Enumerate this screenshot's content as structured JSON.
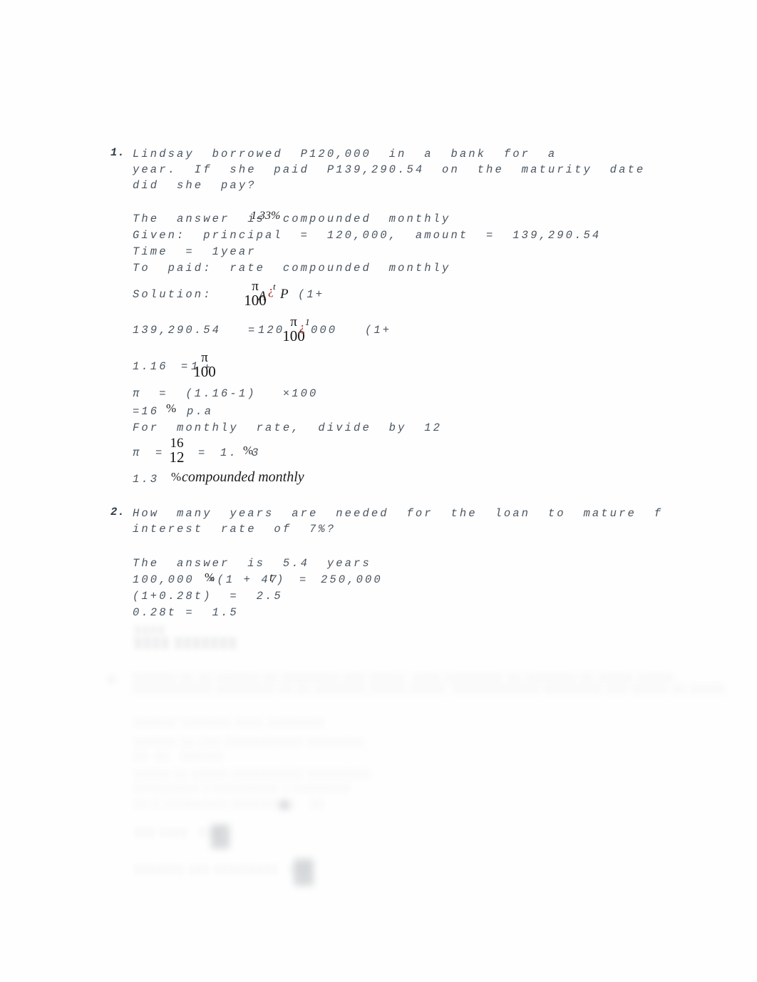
{
  "document": {
    "kind": "scanned-math-homework",
    "page_background": "#fefefe",
    "body_text_color": "#4a5560",
    "error_glyph_color": "#9c1b12"
  },
  "problem1": {
    "number": "1.",
    "question_lines": [
      "Lindsay  borrowed  P120,000  in  a  bank  for  a",
      "year.  If  she  paid  P139,290.54  on  the  maturity  date",
      "did  she  pay?"
    ],
    "answer_line": {
      "base": "The  answer  is  compounded  monthly",
      "overlap": "1.33%"
    },
    "given_line": "Given:  principal  =  120,000,  amount  =  139,290.54",
    "time_line": "Time  =  1year",
    "to_paid_line": "To  paid:  rate  compounded  monthly",
    "solution": {
      "label": "Solution:",
      "expr_a": "A",
      "expr_eq_error": "¿",
      "expr_sup_t": "t",
      "expr_p": "P",
      "expr_tail": "(1+",
      "frac_num": "π",
      "frac_den": "100"
    },
    "step2": {
      "lhs": "139,290.54",
      "eq": "=",
      "rhs_a": "120",
      "rhs_b": "000",
      "tail": "(1+",
      "frac_num": "π",
      "frac_den": "100",
      "error_glyph": "¿",
      "sup": "1"
    },
    "step3": {
      "lhs": "1.16",
      "eq": "=",
      "one": "1",
      "plus": "+",
      "frac_num": "π",
      "frac_den": "100"
    },
    "step4": "π  =  (1.16-1)   ×100",
    "step5": {
      "text": "=16",
      "pct": "%",
      "tail": "p.a"
    },
    "step6": "For  monthly  rate,  divide  by  12",
    "step7": {
      "pi": "π",
      "eq1": "=",
      "frac_num": "16",
      "frac_den": "12",
      "eq2": "=",
      "val_a": "1.",
      "pct": "%",
      "val_b": "3"
    },
    "final": {
      "value": "1.3",
      "pct": "%",
      "text": "compounded monthly"
    }
  },
  "problem2": {
    "number": "2.",
    "question_lines": [
      "How  many  years  are  needed  for  the  loan  to  mature  f",
      "interest  rate  of  7%?"
    ],
    "answer_line": "The  answer  is  5.4  years",
    "step1": {
      "base": "100,000",
      "overlap_a": "%",
      "overlap_b": "×(1 + 47",
      "overlap_c": "t",
      "close": ")",
      "eq": "=",
      "rhs": "250,000"
    },
    "step2": "(1+0.28t)  =  2.5",
    "step3": "0.28t =  1.5"
  },
  "obscured": {
    "note": "blurred-illegible-regions",
    "region_a_lines": [
      "░░░░",
      "░░░░ ░░░░░░░"
    ],
    "problem3_number": "3.",
    "problem3_lines": [
      "░░░░░░ ░░ ░░ ░░░░░░ ░░ ░░░░░░░░ ░░░ ░░░░░  ░░░░ ░░░░░░░░ ░░ ░░░░░░░ ░░ ░░░░░ ░░░░░",
      "░░░░░░░░░░░ ░░░░░░░░ ░░ ░░ ░░░░░░░ ░░░░░ ░░░░░  ░░░░░░░░░░░░ ░░░░░░░░ ░░░ ░░░░░ ░░ ░░░░░"
    ],
    "solution_lines": [
      "░░░░░░ ░░░░░░░ ░░░░ ░░░░░░░░",
      "░░░░░░ ░░ ░░░ ░░░░░░░░░░░ ░░░░░░░░",
      "░░  ░░   ░░░░░░",
      "░░░░░ ░░ ░░░░░ ░░░░░░░░░░ ░░░░░░░░░",
      "░░░░░░░░░ ░ ░░░░░░░░░ ░ ░░░░░░░░",
      "░░ ░ ░░░░░░░░░ ░░░░░░░░░    ░░",
      "░░░ ░░░░   ░░░",
      "░░░░░░░ ░░░ ░░░░░░░░░   ░░░"
    ]
  }
}
